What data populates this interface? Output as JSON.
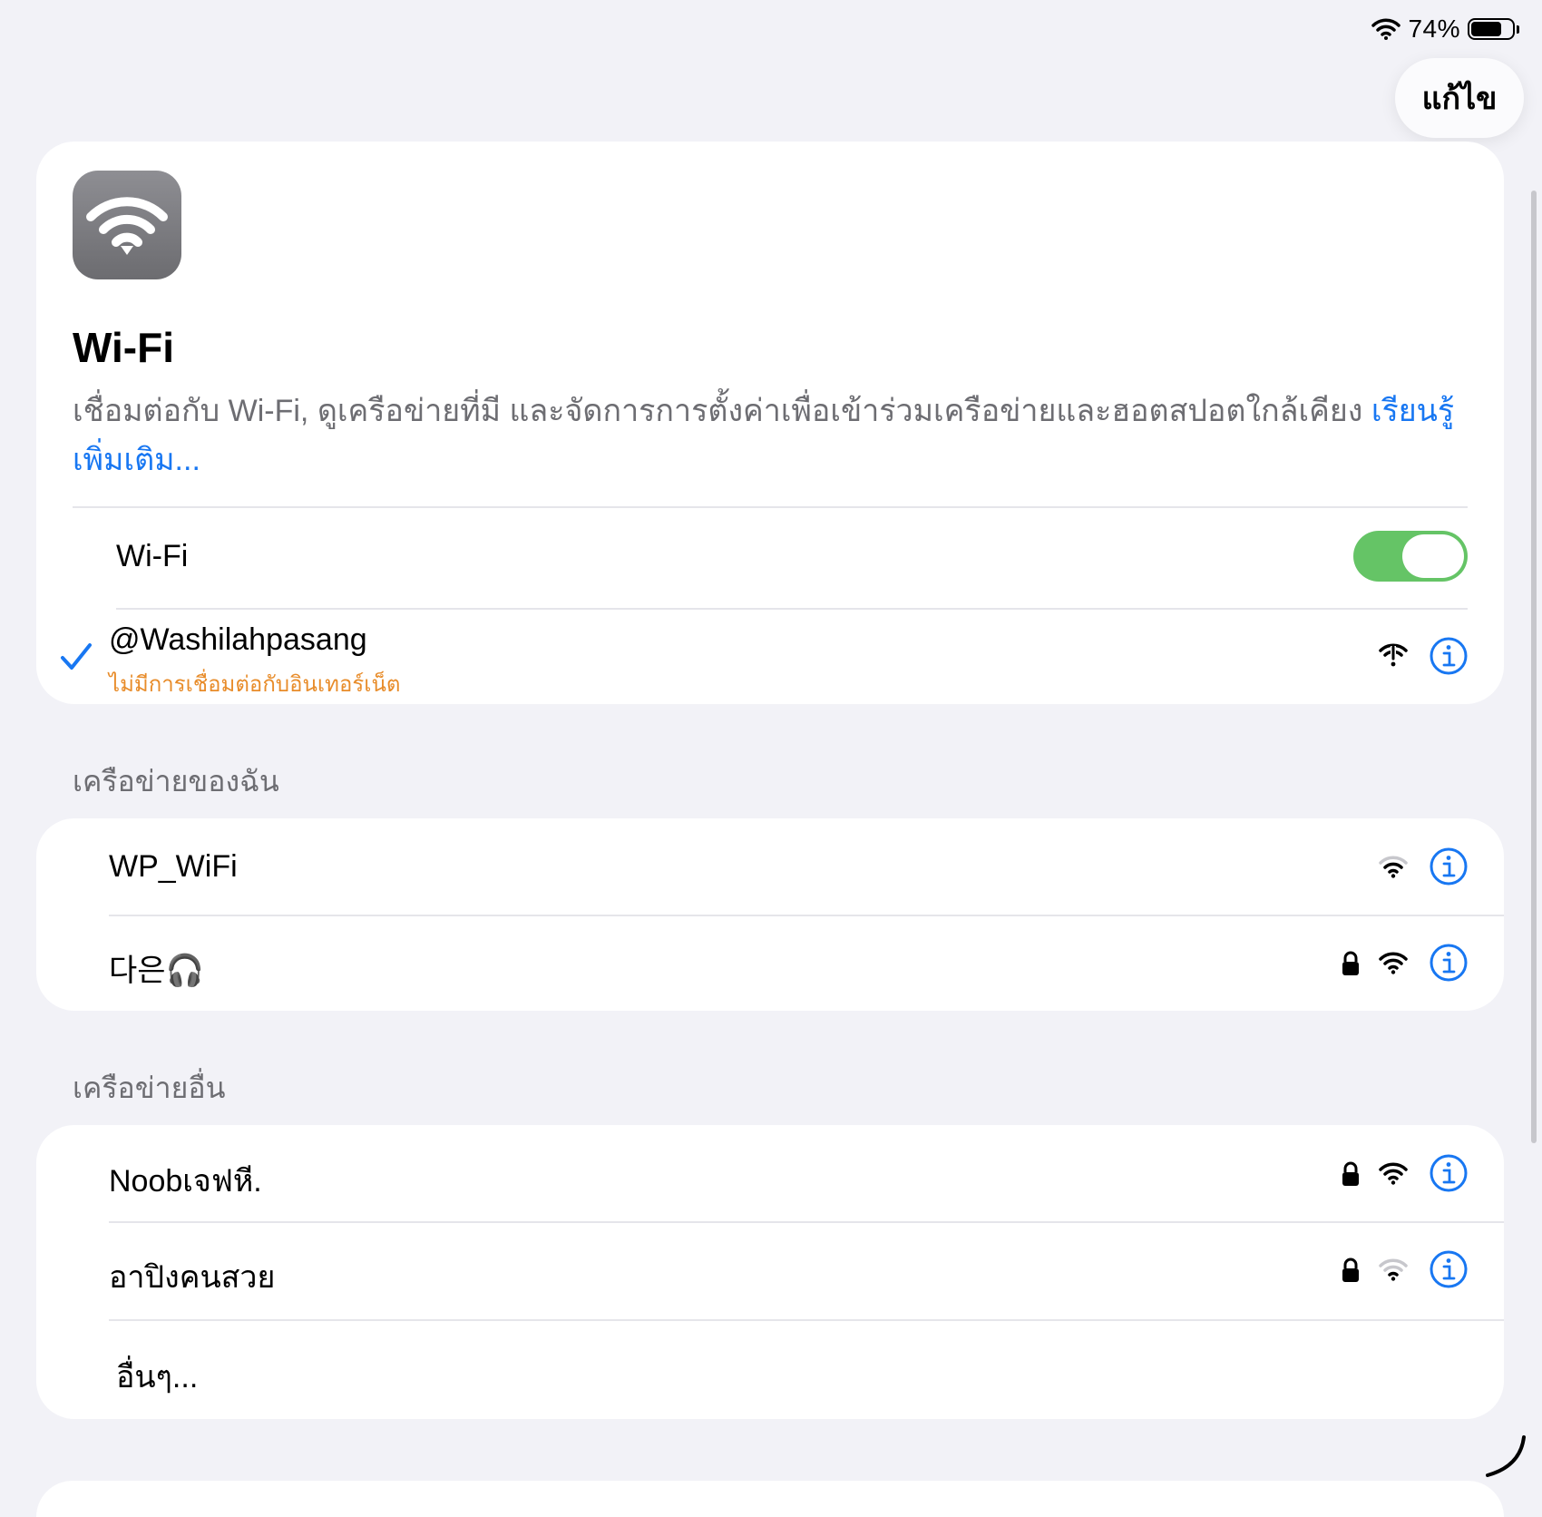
{
  "status_bar": {
    "battery_percent": "74%",
    "battery_level": 0.74
  },
  "toolbar": {
    "edit_label": "แก้ไข"
  },
  "hero": {
    "title": "Wi-Fi",
    "description": "เชื่อมต่อกับ Wi-Fi, ดูเครือข่ายที่มี และจัดการการตั้งค่าเพื่อเข้าร่วมเครือข่ายและฮอตสปอตใกล้เคียง ",
    "learn_more": "เรียนรู้เพิ่มเติม..."
  },
  "wifi_toggle": {
    "label": "Wi-Fi",
    "on": true
  },
  "connected_network": {
    "name": "@Washilahpasang",
    "status": "ไม่มีการเชื่อมต่อกับอินเทอร์เน็ต"
  },
  "my_networks": {
    "header": "เครือข่ายของฉัน",
    "items": [
      {
        "name": "WP_WiFi",
        "locked": false,
        "signal": "medium"
      },
      {
        "name": "다은🎧",
        "locked": true,
        "signal": "full"
      }
    ]
  },
  "other_networks": {
    "header": "เครือข่ายอื่น",
    "items": [
      {
        "name": "Noobเจฟหี.",
        "locked": true,
        "signal": "full"
      },
      {
        "name": "อาปิงคนสวย",
        "locked": true,
        "signal": "weak"
      }
    ],
    "other_label": "อื่นๆ..."
  },
  "colors": {
    "accent": "#1877f2",
    "toggle_on": "#65c466",
    "warning": "#e88c2a"
  }
}
